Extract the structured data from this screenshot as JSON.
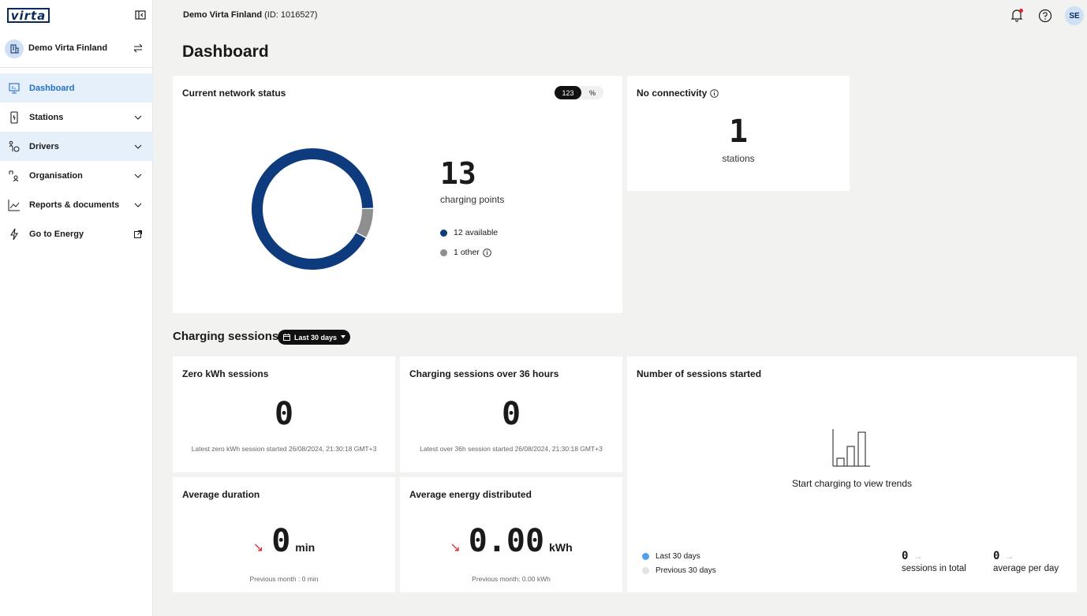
{
  "sidebar": {
    "logo": "virta",
    "org_name": "Demo Virta Finland",
    "items": [
      {
        "label": "Dashboard",
        "icon": "dashboard-icon"
      },
      {
        "label": "Stations",
        "icon": "station-icon"
      },
      {
        "label": "Drivers",
        "icon": "driver-icon"
      },
      {
        "label": "Organisation",
        "icon": "organisation-icon"
      },
      {
        "label": "Reports & documents",
        "icon": "chart-icon"
      },
      {
        "label": "Go to Energy",
        "icon": "lightning-icon"
      }
    ]
  },
  "topbar": {
    "org": "Demo Virta Finland",
    "id": "(ID: 1016527)",
    "user_initials": "SE"
  },
  "page_title": "Dashboard",
  "network": {
    "title": "Current network status",
    "toggle_count": "123",
    "toggle_percent": "%",
    "total": "13",
    "total_label": "charging points",
    "available_count": 12,
    "other_count": 1,
    "available_num": "12",
    "available_label": "available",
    "other_num": "1",
    "other_label": "other",
    "colors": {
      "available": "#0e3a7e",
      "other": "#8f8f8f"
    }
  },
  "connectivity": {
    "title": "No connectivity",
    "value": "1",
    "unit": "stations"
  },
  "sessions": {
    "title": "Charging sessions",
    "range": "Last 30 days",
    "zero_kwh": {
      "title": "Zero kWh sessions",
      "value": "0",
      "note": "Latest zero kWh session started 26/08/2024, 21:30:18 GMT+3"
    },
    "over_36h": {
      "title": "Charging sessions over 36 hours",
      "value": "0",
      "note": "Latest over 36h session started 26/08/2024, 21:30:18 GMT+3"
    },
    "avg_duration": {
      "title": "Average duration",
      "value": "0",
      "unit": "min",
      "note": "Previous month : 0 min"
    },
    "avg_energy": {
      "title": "Average energy distributed",
      "value": "0.00",
      "unit": "kWh",
      "note": "Previous month: 0.00 kWh"
    },
    "started": {
      "title": "Number of sessions started",
      "empty_text": "Start charging to view trends",
      "legend_current": "Last 30 days",
      "legend_previous": "Previous 30 days",
      "total_value": "0",
      "total_label": "sessions in total",
      "avg_value": "0",
      "avg_label": "average per day",
      "colors": {
        "current": "#4da3f0",
        "previous": "#e3e3e3"
      }
    }
  }
}
